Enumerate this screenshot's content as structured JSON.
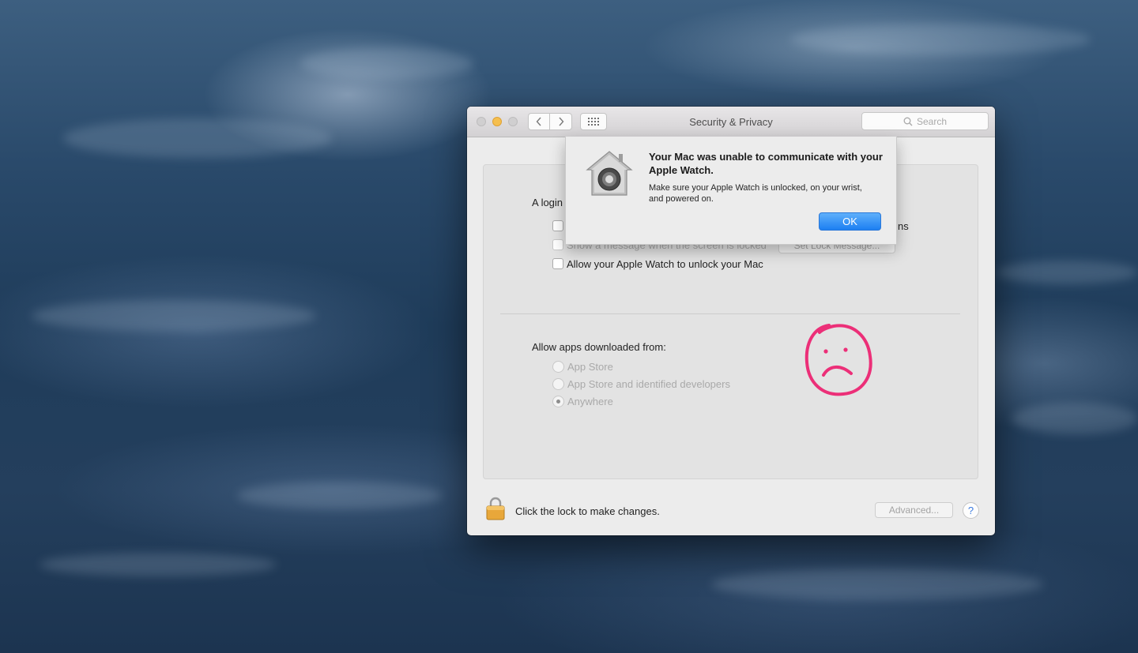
{
  "window": {
    "title": "Security & Privacy",
    "search_placeholder": "Search"
  },
  "general": {
    "login_label_partial": "A login",
    "row1_trailing_text": "ns",
    "show_message_label": "Show a message when the screen is locked",
    "set_lock_message_button": "Set Lock Message...",
    "apple_watch_unlock_label": "Allow your Apple Watch to unlock your Mac"
  },
  "gatekeeper": {
    "heading": "Allow apps downloaded from:",
    "options": [
      {
        "label": "App Store",
        "selected": false
      },
      {
        "label": "App Store and identified developers",
        "selected": false
      },
      {
        "label": "Anywhere",
        "selected": true
      }
    ]
  },
  "footer": {
    "lock_text": "Click the lock to make changes.",
    "advanced_button": "Advanced...",
    "help_button": "?"
  },
  "alert": {
    "title": "Your Mac was unable to communicate with your Apple Watch.",
    "message": "Make sure your Apple Watch is unlocked, on your wrist, and powered on.",
    "ok_button": "OK"
  },
  "colors": {
    "accent_blue": "#1c7ff2",
    "traffic_yellow": "#f5bf4f",
    "annotation_pink": "#ec2f78",
    "lock_gold": "#e8a73a"
  },
  "icons": {
    "alert_icon": "security-house-icon",
    "lock": "padlock-icon",
    "annotation": "sad-face-drawing"
  }
}
